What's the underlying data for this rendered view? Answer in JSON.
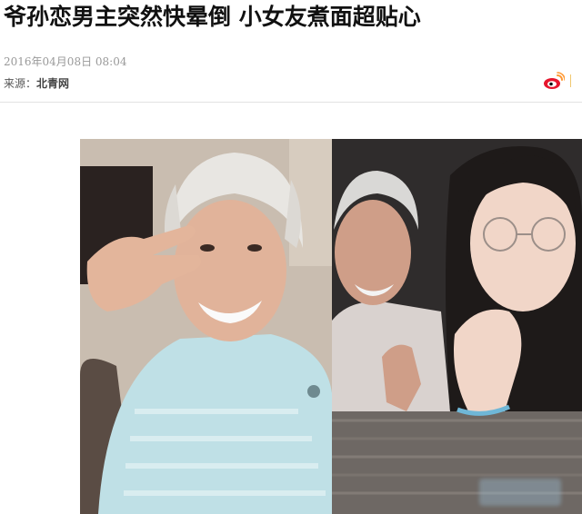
{
  "article": {
    "title": "爷孙恋男主突然快晕倒 小女友煮面超贴心",
    "date": "2016年04月08日 08:04",
    "source_label": "来源：",
    "source_name": "北青网"
  },
  "share": {
    "icons": [
      "weibo-icon"
    ]
  },
  "colors": {
    "weibo_red": "#e6162d",
    "weibo_orange": "#ff9933",
    "divider": "#e3e3e3"
  }
}
